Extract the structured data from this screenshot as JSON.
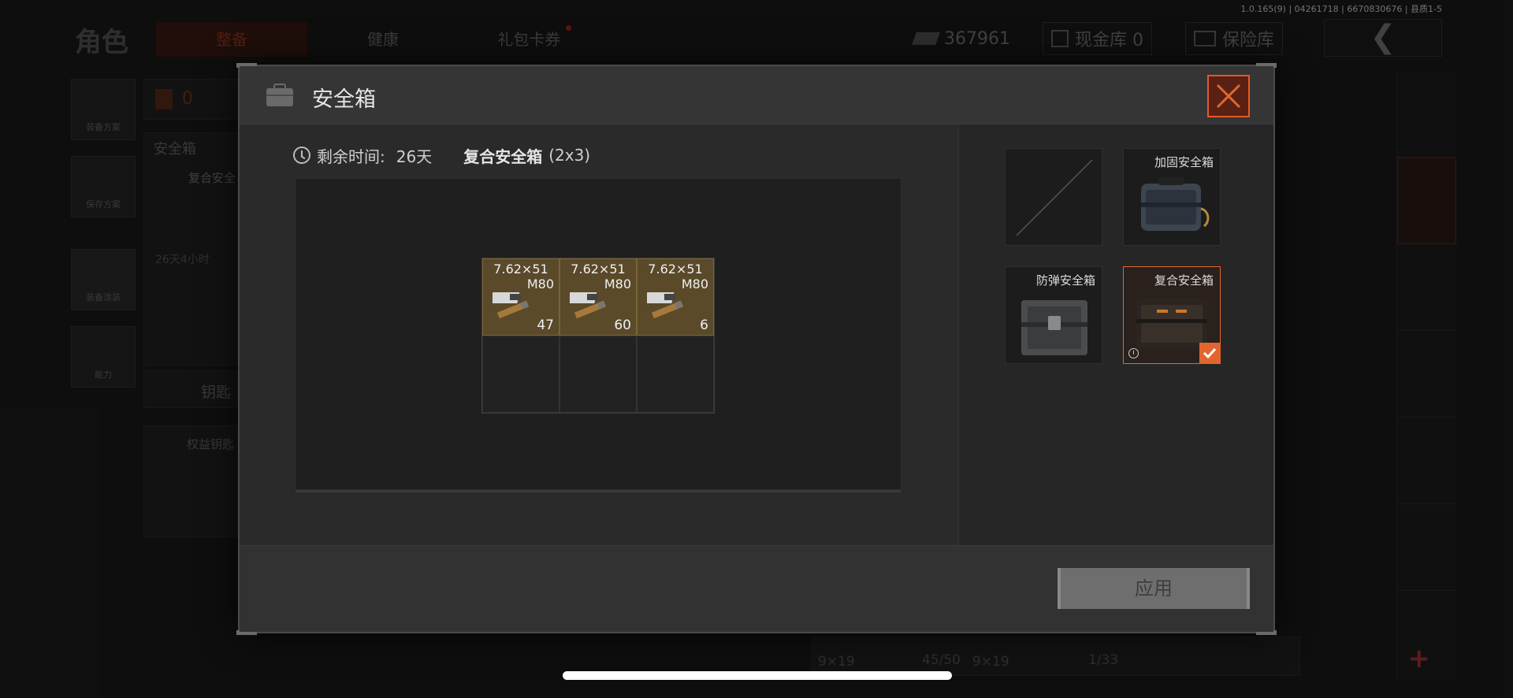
{
  "version_text": "1.0.165(9) | 04261718 | 6670830676 | 县质1-5",
  "background": {
    "title": "角色",
    "tabs": [
      {
        "label": "整备",
        "active": true
      },
      {
        "label": "健康",
        "active": false
      },
      {
        "label": "礼包卡券",
        "active": false
      }
    ],
    "currency_value": "367961",
    "cash_vault_label": "现金库 0",
    "insurance_label": "保险库",
    "left_buttons": [
      "装备方案",
      "保存方案",
      "装备涂装",
      "能力"
    ],
    "panel_labels": {
      "backpack_count": "0",
      "safe_box": "安全箱",
      "composite_box": "复合安全",
      "remaining_short": "26天4小时",
      "keys": "钥匙",
      "benefit_key": "权益钥匙"
    },
    "bottom_labels": [
      "9×19",
      "45/50",
      "9×19",
      "1/33"
    ]
  },
  "modal": {
    "title": "安全箱",
    "remaining_time_label": "剩余时间:",
    "remaining_time_value": "26天",
    "case_name": "复合安全箱",
    "case_size": "(2x3)",
    "grid_items": [
      {
        "caliber": "7.62×51",
        "type": "M80",
        "count": "47",
        "icon": "ammo-box-icon"
      },
      {
        "caliber": "7.62×51",
        "type": "M80",
        "count": "60",
        "icon": "ammo-box-icon"
      },
      {
        "caliber": "7.62×51",
        "type": "M80",
        "count": "6",
        "icon": "ammo-box-icon"
      }
    ],
    "case_options": [
      {
        "name": "",
        "state": "empty"
      },
      {
        "name": "加固安全箱",
        "state": "available"
      },
      {
        "name": "防弹安全箱",
        "state": "available"
      },
      {
        "name": "复合安全箱",
        "state": "selected"
      }
    ],
    "apply_label": "应用"
  },
  "colors": {
    "accent": "#e2652e",
    "item_bg": "#5a4a2a",
    "close_bg": "#592114"
  }
}
